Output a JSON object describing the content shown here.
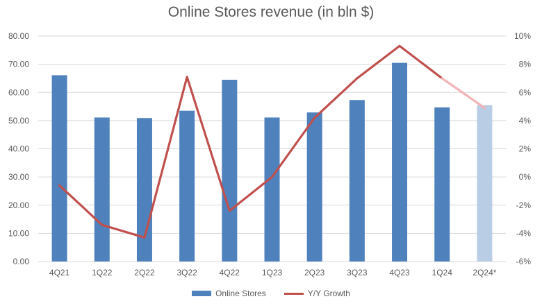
{
  "chart_data": {
    "type": "bar",
    "title": "Online Stores revenue (in bln $)",
    "categories": [
      "4Q21",
      "1Q22",
      "2Q22",
      "3Q22",
      "4Q22",
      "1Q23",
      "2Q23",
      "3Q23",
      "4Q23",
      "1Q24",
      "2Q24*"
    ],
    "series": [
      {
        "name": "Online Stores",
        "kind": "bar",
        "axis": "left",
        "color": "#4f81bd",
        "estimate_color": "#b9cde5",
        "values": [
          66.1,
          51.1,
          50.9,
          53.5,
          64.5,
          51.1,
          52.9,
          57.3,
          70.5,
          54.7,
          55.5
        ]
      },
      {
        "name": "Y/Y Growth",
        "kind": "line",
        "axis": "right",
        "color": "#c0504d",
        "estimate_color": "#f2b3b5",
        "values": [
          -0.6,
          -3.4,
          -4.3,
          7.1,
          -2.4,
          0.0,
          4.2,
          7.0,
          9.3,
          7.0,
          4.9
        ]
      }
    ],
    "estimate_index": 10,
    "y_left": {
      "min": 0,
      "max": 80,
      "step": 10,
      "tick_labels": [
        "0.00",
        "10.00",
        "20.00",
        "30.00",
        "40.00",
        "50.00",
        "60.00",
        "70.00",
        "80.00"
      ]
    },
    "y_right": {
      "min": -6,
      "max": 10,
      "step": 2,
      "tick_labels": [
        "-6%",
        "-4%",
        "-2%",
        "0%",
        "2%",
        "4%",
        "6%",
        "8%",
        "10%"
      ]
    },
    "grid": true,
    "legend_position": "bottom-center"
  },
  "legend": {
    "bar_label": "Online Stores",
    "line_label": "Y/Y Growth"
  }
}
